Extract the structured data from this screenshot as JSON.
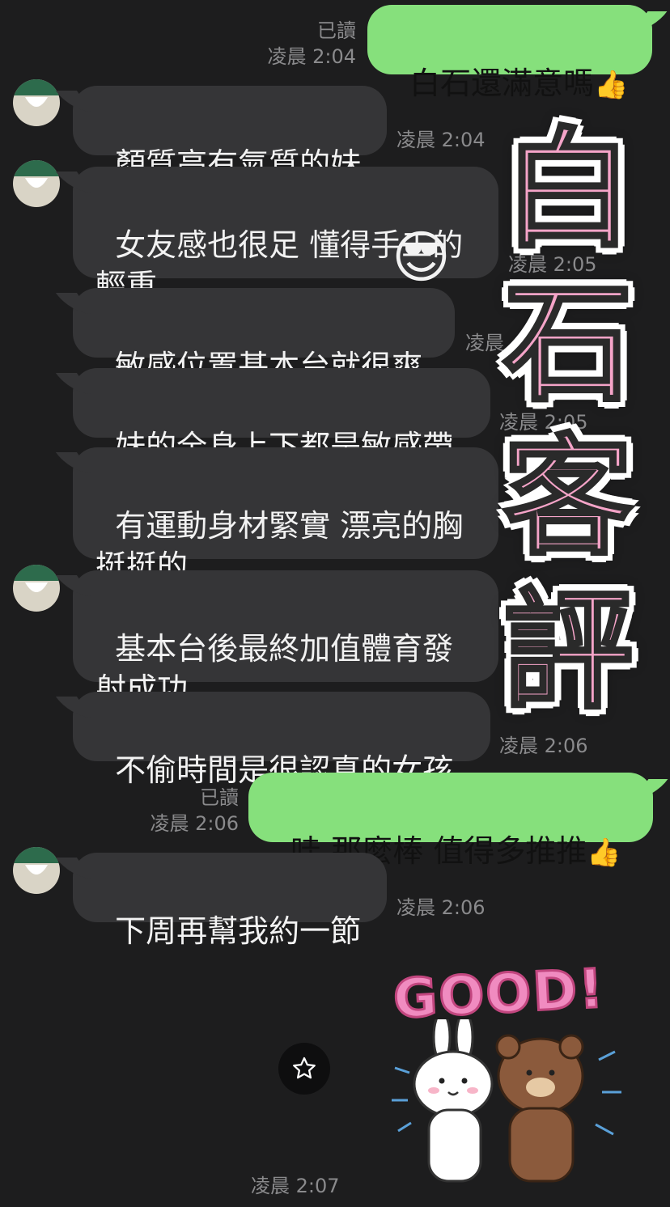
{
  "colors": {
    "background": "#1d1d1e",
    "outgoing": "#86e07c",
    "incoming": "#353537",
    "sticker_pink": "#f5a4c8"
  },
  "messages": [
    {
      "side": "out",
      "text": "白石還滿意嗎",
      "emoji": "👍",
      "read": "已讀",
      "time": "凌晨 2:04"
    },
    {
      "side": "in",
      "text": "顏質高有氣質的妹",
      "time": "凌晨 2:04"
    },
    {
      "side": "in",
      "text": "女友感也很足 懂得手工的\n輕重",
      "time": "凌晨 2:05"
    },
    {
      "side": "in",
      "text": "敏感位置基本台就很爽",
      "time": "凌晨"
    },
    {
      "side": "in",
      "text": "妹的全身上下都是敏感帶",
      "time": "凌晨 2:05"
    },
    {
      "side": "in",
      "text": "有運動身材緊實 漂亮的胸\n挺挺的"
    },
    {
      "side": "in",
      "text": "基本台後最終加值體育發\n射成功"
    },
    {
      "side": "in",
      "text": "不偷時間是很認真的女孩",
      "time": "凌晨 2:06"
    },
    {
      "side": "out",
      "text": "哇 那麼棒 值得多推推",
      "emoji": "👍",
      "read": "已讀",
      "time": "凌晨 2:06"
    },
    {
      "side": "in",
      "text": "下周再幫我約一節",
      "time": "凌晨 2:06"
    }
  ],
  "overlay_title": [
    "白",
    "石",
    "客",
    "評"
  ],
  "emoji_overlay": "😎",
  "sticker": {
    "text": "GOOD!",
    "time": "凌晨 2:07"
  },
  "icons": {
    "favorite": "star-icon",
    "avatar": "shop-avatar-icon"
  }
}
